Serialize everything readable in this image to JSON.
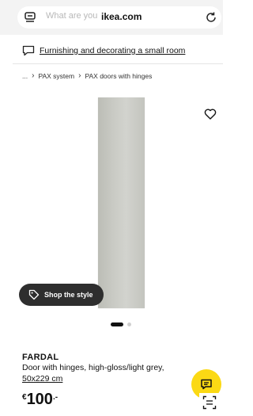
{
  "browser": {
    "url": "ikea.com",
    "search_ghost": "What are you"
  },
  "banner": {
    "link_text": "Furnishing and decorating a small room"
  },
  "breadcrumb": {
    "ellipsis": "...",
    "items": [
      "PAX system",
      "PAX doors with hinges"
    ]
  },
  "gallery": {
    "shop_style_label": "Shop the style",
    "slide_count": 2,
    "active_slide": 1
  },
  "product": {
    "name": "FARDAL",
    "description": "Door with hinges, high-gloss/light grey,",
    "size": "50x229 cm",
    "price": {
      "currency": "€",
      "integer": "100",
      "decimal": ".-"
    }
  },
  "icons": {
    "menu": "menu-icon",
    "reload": "reload-icon",
    "banner": "chat-bubble-icon",
    "wishlist": "heart-icon",
    "shop_style": "tag-icon",
    "chat": "chat-icon",
    "scan": "scan-icon"
  },
  "colors": {
    "chat_fab": "#fbd914",
    "shop_style_bg": "#2e2e2e",
    "door": "#c8c9c3"
  }
}
